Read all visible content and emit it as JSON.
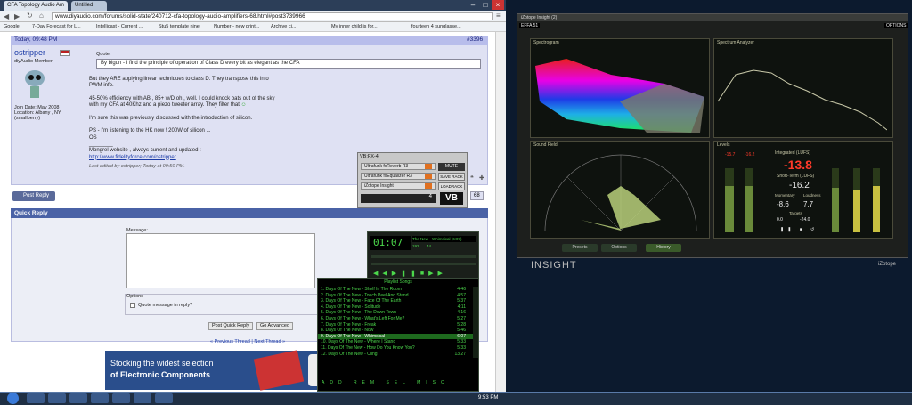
{
  "browser": {
    "tabs": [
      "CFA Topology Audio Am",
      "Untitled"
    ],
    "url": "www.diyaudio.com/forums/solid-state/240712-cfa-topology-audio-amplifiers-68.html#post3739966",
    "bookmarks": [
      "Google",
      "7-Day Forecast for L...",
      "Intellicast - Current ...",
      "Stu5 template nine",
      "Number - new print...",
      "Archive ci...",
      "My inner child is for...",
      "fourteen 4 sunglasse..."
    ]
  },
  "post": {
    "date": "Today, 09:48 PM",
    "number": "#3396",
    "username": "ostripper",
    "title": "diyAudio Member",
    "join": "Join Date: May 2008",
    "location": "Location: Albany , NY",
    "location2": "(smallberry)",
    "quote_label": "Quote:",
    "quote": "By bigun - I find the principle of operation of Class D every bit as elegant as the CFA",
    "lines": [
      "But they ARE applying linear techniques to class D. They transpose this into",
      "PWM info.",
      "",
      "45-50% efficiency with AB , 85+ w/D oh , well. I could knock bats out of the sky",
      "with my CFA at 40Khz and a piezo tweeter array. They filter that",
      "",
      "I'm sure this was previously discussed with the introduction of silicon.",
      "",
      "PS - I'm listening to the HK now ! 200W of silicon ...",
      "OS",
      "________",
      "Mongrel website , always current and updated :"
    ],
    "link": "http://www.fidelityforce.com/ostripper",
    "edited": "Last edited by ostripper; Today at 09:50 PM.",
    "reply_btn": "Post Reply",
    "page": "68"
  },
  "quickreply": {
    "title": "Quick Reply",
    "message": "Message:",
    "options": "Options",
    "quote_opt": "Quote message in reply?",
    "btn_post": "Post Quick Reply",
    "btn_adv": "Go Advanced",
    "nav_prev": "« Previous Thread",
    "nav_sep": "|",
    "nav_next": "Next Thread »"
  },
  "banner": {
    "line1": "Stocking the widest selection",
    "line2": "of Electronic Components"
  },
  "vb": {
    "title": "VB:FX-4",
    "rows": [
      "Ultrafunk fxReverb R3",
      "Ultrafunk fxEqualizer R3",
      "iZotope Insight"
    ],
    "mute": "MUTE",
    "save": "SAVE RACK",
    "load": "LOADRACK",
    "num": "4",
    "logo": "VB"
  },
  "winamp": {
    "time": "01:07",
    "song": "The New - Whimsical (6:07)",
    "kbps": "192",
    "khz": "44",
    "playlist_title": "Playlist Songs",
    "tracks": [
      [
        "1. Days Of The New - Shelf In The Room",
        "4:46"
      ],
      [
        "2. Days Of The New - Touch Peel And Stand",
        "4:57"
      ],
      [
        "3. Days Of The New - Face Of The Earth",
        "5:37"
      ],
      [
        "4. Days Of The New - Solitude",
        "4:11"
      ],
      [
        "5. Days Of The New - The Down Town",
        "4:16"
      ],
      [
        "6. Days Of The New - What's Left For Me?",
        "5:27"
      ],
      [
        "7. Days Of The New - Freak",
        "5:28"
      ],
      [
        "8. Days Of The New - Now",
        "5:46"
      ],
      [
        "9. Days Of The New - Whimsical",
        "6:07"
      ],
      [
        "10. Days Of The New - Where I Stand",
        "5:33"
      ],
      [
        "11. Days Of The New - How Do You Know You?",
        "5:33"
      ],
      [
        "12. Days Of The New - Cling",
        "13:27"
      ]
    ],
    "active": 8
  },
  "izotope": {
    "title": "iZotope Insight (2)",
    "preset": "EFFA 51",
    "options": "OPTIONS",
    "p_spectro": "Spectrogram",
    "p_spectrum": "Spectrum Analyzer",
    "p_sound": "Sound Field",
    "p_levels": "Levels",
    "integrated_lbl": "Integrated (LUFS)",
    "integrated": "-13.8",
    "short_lbl": "Short-Term (LUFS)",
    "short": "-16.2",
    "momentary_lbl": "Momentary",
    "loudness_lbl": "Loudness",
    "momentary": "-8.6",
    "range": "7.7",
    "targets": "Targets",
    "peak": "0.0",
    "target_val": "-24.0",
    "btns": [
      "Presets",
      "Options",
      "History"
    ],
    "logo": "INSIGHT",
    "brand": "iZotope",
    "peak_l": "-15.7",
    "peak_r": "-16.2"
  },
  "taskbar": {
    "time": "9:53 PM"
  },
  "colors": {
    "accent": "#4a62a6",
    "wamp_green": "#4cd84c",
    "izo_red": "#ff3a2a"
  }
}
